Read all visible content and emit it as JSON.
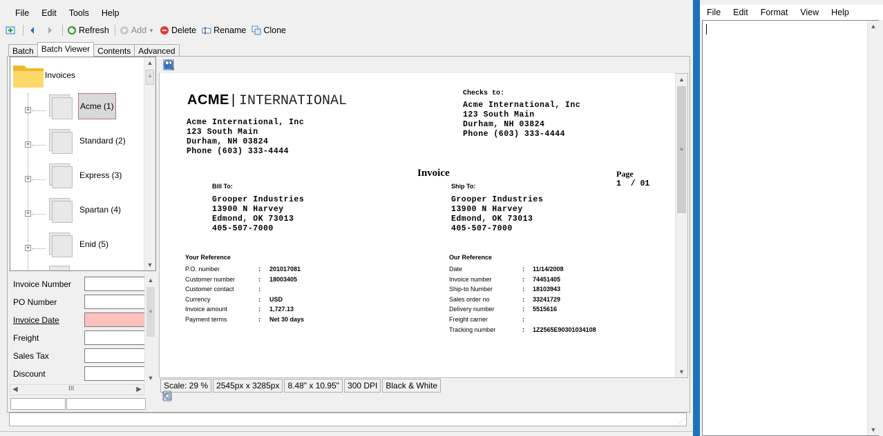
{
  "left_window": {
    "menu": [
      "File",
      "Edit",
      "Tools",
      "Help"
    ],
    "toolbar": {
      "refresh": "Refresh",
      "add": "Add",
      "delete": "Delete",
      "rename": "Rename",
      "clone": "Clone"
    },
    "tabs": [
      "Batch",
      "Batch Viewer",
      "Contents",
      "Advanced"
    ],
    "active_tab": "Batch Viewer",
    "tree": {
      "root": "Invoices",
      "items": [
        "Acme (1)",
        "Standard (2)",
        "Express (3)",
        "Spartan (4)",
        "Enid (5)"
      ],
      "selected": "Acme (1)"
    },
    "fields": [
      {
        "label": "Invoice Number",
        "value": ""
      },
      {
        "label": "PO Number",
        "value": ""
      },
      {
        "label": "Invoice Date",
        "value": ""
      },
      {
        "label": "Freight",
        "value": ""
      },
      {
        "label": "Sales Tax",
        "value": ""
      },
      {
        "label": "Discount",
        "value": ""
      }
    ],
    "status": {
      "scale": "Scale: 29 %",
      "pixels": "2545px x 3285px",
      "inches": "8.48\" x 10.95\"",
      "dpi": "300 DPI",
      "mode": "Black & White"
    },
    "colors": {
      "invalid_field": "#ffc0c0",
      "selection": "#d9d9d9"
    }
  },
  "document": {
    "logo_left": "ACME",
    "logo_right": "INTERNATIONAL",
    "company": [
      "Acme International, Inc",
      "123 South Main",
      "Durham, NH 03824",
      "Phone (603) 333-4444"
    ],
    "checks_to_label": "Checks to:",
    "checks_to": [
      "Acme International, Inc",
      "123 South Main",
      "Durham, NH 03824",
      "Phone (603) 333-4444"
    ],
    "title": "Invoice",
    "page_label": "Page",
    "page_value": "1  / 01",
    "bill_to_label": "Bill To:",
    "bill_to": [
      "Grooper Industries",
      "13900 N Harvey",
      "Edmond, OK 73013",
      "405-507-7000"
    ],
    "ship_to_label": "Ship To:",
    "ship_to": [
      "Grooper Industries",
      "13900 N Harvey",
      "Edmond, OK 73013",
      "405-507-7000"
    ],
    "your_ref_label": "Your Reference",
    "your_ref": [
      {
        "k": "P.O. number",
        "v": "201017081"
      },
      {
        "k": "Customer number",
        "v": "18003405"
      },
      {
        "k": "Customer contact",
        "v": ""
      },
      {
        "k": "Currency",
        "v": "USD"
      },
      {
        "k": "Invoice amount",
        "v": "1,727.13"
      },
      {
        "k": "Payment terms",
        "v": "Net 30 days"
      }
    ],
    "our_ref_label": "Our Reference",
    "our_ref": [
      {
        "k": "Date",
        "v": "11/14/2008"
      },
      {
        "k": "Invoice number",
        "v": "74451405"
      },
      {
        "k": "Ship-to Number",
        "v": "18103943"
      },
      {
        "k": "Sales order no",
        "v": "33241729"
      },
      {
        "k": "Delivery number",
        "v": "5515616"
      },
      {
        "k": "Freight carrier",
        "v": ""
      },
      {
        "k": "Tracking number",
        "v": "1Z2565E90301034108"
      }
    ]
  },
  "right_window": {
    "menu": [
      "File",
      "Edit",
      "Format",
      "View",
      "Help"
    ],
    "text": ""
  }
}
